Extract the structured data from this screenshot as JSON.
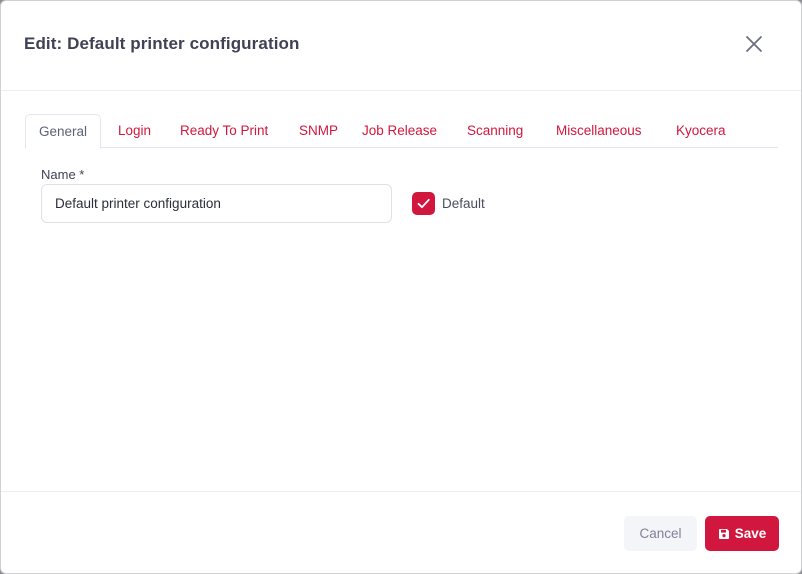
{
  "dialog": {
    "title": "Edit: Default printer configuration",
    "close_icon": "close-icon"
  },
  "tabs": [
    {
      "label": "General",
      "active": true
    },
    {
      "label": "Login",
      "active": false
    },
    {
      "label": "Ready To Print",
      "active": false
    },
    {
      "label": "SNMP",
      "active": false
    },
    {
      "label": "Job Release",
      "active": false
    },
    {
      "label": "Scanning",
      "active": false
    },
    {
      "label": "Miscellaneous",
      "active": false
    },
    {
      "label": "Kyocera",
      "active": false
    }
  ],
  "form": {
    "name_label": "Name *",
    "name_value": "Default printer configuration",
    "default_label": "Default",
    "default_checked": true,
    "checkbox_icon": "checkmark-icon"
  },
  "footer": {
    "cancel_label": "Cancel",
    "save_label": "Save",
    "save_icon": "floppy-disk-icon"
  },
  "colors": {
    "accent": "#d1173d",
    "title": "#3f4254",
    "muted": "#7e8299"
  }
}
